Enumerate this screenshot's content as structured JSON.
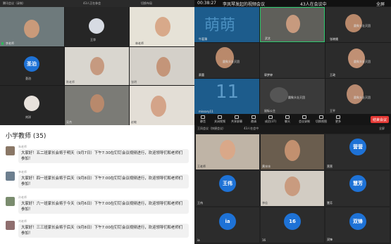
{
  "colors": {
    "blue_avatar": "#1e72d6",
    "end_red": "#e53935",
    "mic_green": "#2dbd5a",
    "active_border": "#2ecc71"
  },
  "q1": {
    "title_left": "腾讯会议（录制）",
    "title_mid": "43人正在参会",
    "title_right": "切换布局",
    "avatar_name": "圣泊",
    "tile_names": [
      "李老师",
      "王华",
      "林老师",
      "圣泊",
      "陈老师",
      "张明",
      "刘洋",
      "吴杰",
      "赵敏"
    ]
  },
  "q2": {
    "time": "00:38:27",
    "meeting_title": "李凤琴发起的视频会议",
    "participants": "43人在会议中",
    "fullscreen": "全屏",
    "big_text": "萌萌",
    "number_text": "11",
    "caption": "圆象头壮灭团",
    "names": [
      "牛葛薄",
      "武艺",
      "张晓娥",
      "蔡蕾",
      "宋梓贤",
      "郭梦婷",
      "王政",
      "王政锐",
      "missary11",
      "鼠标公主",
      "王平"
    ],
    "toolbar": [
      "静音",
      "关闭视频",
      "共享屏幕",
      "邀请",
      "成员(37)",
      "聊天",
      "会议录制",
      "切换视图",
      "更多"
    ],
    "end_button": "结束会议"
  },
  "chat": {
    "title": "小学教师 (35)",
    "messages": [
      {
        "who": "朱老师",
        "text": "大家好！五二班家长会将于明天（9月7日）下午7:30在钉钉会议视频进行，欢迎领导们和老师们参加！"
      },
      {
        "who": "李老师",
        "text": "大家好！四一班家长会将于后天（9月8日）下午7:00在钉钉会议视频进行，欢迎领导们和老师们参加！"
      },
      {
        "who": "孙老师",
        "text": "大家好！六一班家长会将于今天（9月6日）下午7:00在钉钉会议视频进行，欢迎领导们和老师们参加！"
      },
      {
        "who": "刘老师",
        "text": "大家好！三三班家长会将于后天（9月8日）下午7:00在钉钉会议视频进行，欢迎领导们和老师们参加！"
      }
    ]
  },
  "q4": {
    "title": "王凤会议（快捷会议）",
    "participants": "43人在会中",
    "fullscreen": "全屏",
    "avatars": [
      "营营",
      "王伟",
      "慧芳",
      "ia",
      "16",
      "双锋"
    ],
    "names": [
      "王老师",
      "黄冰冰",
      "赵静",
      "王伟",
      "慧芳",
      "李佳",
      "ia",
      "16",
      "双锋"
    ]
  }
}
